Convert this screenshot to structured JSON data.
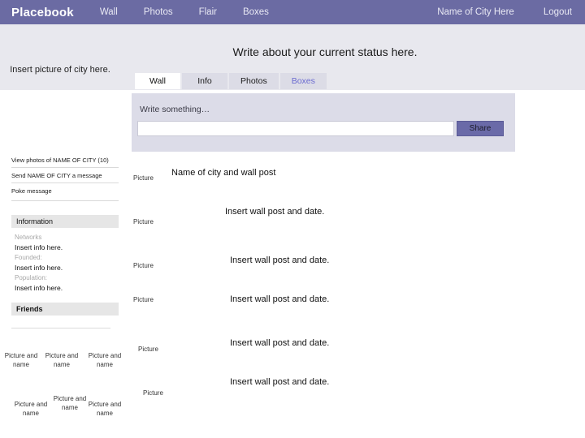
{
  "header": {
    "brand": "Placebook",
    "nav_left": [
      {
        "label": "Wall"
      },
      {
        "label": "Photos"
      },
      {
        "label": "Flair"
      },
      {
        "label": "Boxes"
      }
    ],
    "nav_right": [
      {
        "label": "Name of City Here"
      },
      {
        "label": "Logout"
      }
    ]
  },
  "main": {
    "status_headline": "Write about your current status here.",
    "tabs": [
      {
        "label": "Wall",
        "active": true
      },
      {
        "label": "Info",
        "active": false
      },
      {
        "label": "Photos",
        "active": false
      },
      {
        "label": "Boxes",
        "active": false,
        "accent": true
      }
    ],
    "compose": {
      "label": "Write something…",
      "value": "",
      "placeholder": "",
      "share_label": "Share"
    },
    "posts": [
      {
        "picture_label": "Picture",
        "text": "Name of city and wall post"
      },
      {
        "picture_label": "Picture",
        "text": "Insert wall post and date."
      },
      {
        "picture_label": "Picture",
        "text": "Insert wall post and date."
      },
      {
        "picture_label": "Picture",
        "text": "Insert wall post and date."
      },
      {
        "picture_label": "Picture",
        "text": "Insert wall post and date."
      },
      {
        "picture_label": "Picture",
        "text": "Insert wall post and date."
      }
    ]
  },
  "sidebar": {
    "photo_placeholder": "Insert picture of city here.",
    "links": [
      {
        "label": "View photos of  NAME OF CITY (10)"
      },
      {
        "label": "Send NAME OF CITY a message"
      },
      {
        "label": "Poke message"
      }
    ],
    "information": {
      "heading": "Information",
      "rows": [
        {
          "term": "Networks",
          "value": "Insert info here."
        },
        {
          "term": "Founded:",
          "value": "Insert info here."
        },
        {
          "term": "Population:",
          "value": "Insert info here."
        }
      ]
    },
    "friends": {
      "heading": "Friends",
      "items": [
        {
          "label": "Picture and name"
        },
        {
          "label": "Picture and name"
        },
        {
          "label": "Picture and name"
        },
        {
          "label": "Picture and name"
        },
        {
          "label": "Picture and name"
        },
        {
          "label": "Picture and name"
        }
      ]
    }
  },
  "colors": {
    "header_bar": "#6b6ba3",
    "band": "#e8e8ee",
    "compose_bg": "#dcdce8",
    "tab_inactive": "#dcdce6",
    "tab_active": "#ffffff",
    "accent_text": "#6a6ad0",
    "share_button": "#6a6aa8",
    "section_head": "#e6e6e6"
  }
}
